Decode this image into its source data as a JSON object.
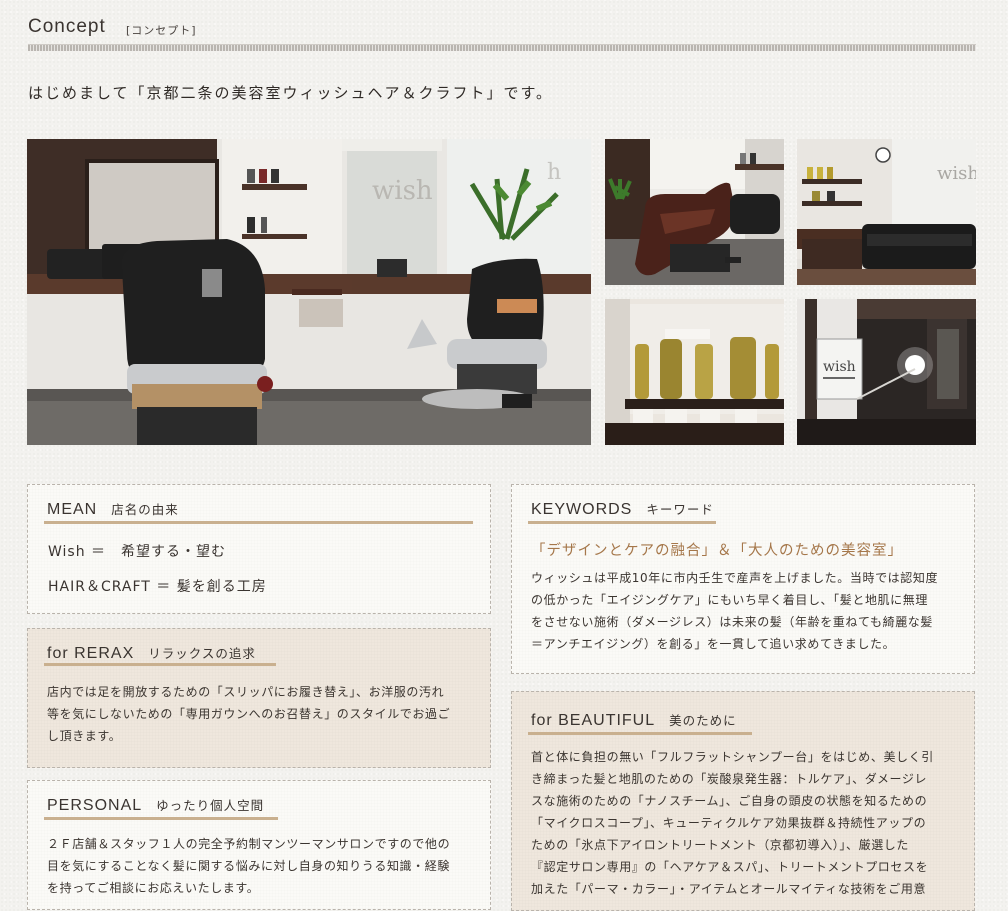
{
  "header": {
    "title_en": "Concept",
    "title_jp": "[コンセプト]",
    "intro": "はじめまして「京都二条の美容室ウィッシュヘア＆クラフト」です。"
  },
  "photos": {
    "main_sign_text": "wish",
    "small_sign_text": "wish",
    "icons": [
      "salon-interior-photo",
      "shampoo-chair-photo",
      "waiting-area-photo",
      "product-shelf-photo",
      "shop-sign-photo"
    ]
  },
  "mean": {
    "title_en": "MEAN",
    "title_jp": "店名の由来",
    "line1": "Wish ＝　希望する・望む",
    "line2": "HAIR＆CRAFT ＝ 髪を創る工房"
  },
  "relax": {
    "title_en": "for RERAX",
    "title_jp": "リラックスの追求",
    "lines": [
      "店内では足を開放するための「スリッパにお履き替え」、お洋服の汚れ",
      "等を気にしないための「専用ガウンへのお召替え」のスタイルでお過ご",
      "し頂きます。"
    ]
  },
  "personal": {
    "title_en": "PERSONAL",
    "title_jp": "ゆったり個人空間",
    "lines": [
      "２Ｆ店舗＆スタッフ１人の完全予約制マンツーマンサロンですので他の",
      "目を気にすることなく髪に関する悩みに対し自身の知りうる知識・経験",
      "を持ってご相談にお応えいたします。"
    ]
  },
  "keywords": {
    "title_en": "KEYWORDS",
    "title_jp": "キーワード",
    "headline": "「デザインとケアの融合」＆「大人のための美容室」",
    "lines": [
      "ウィッシュは平成10年に市内壬生で産声を上げました。当時では認知度",
      "の低かった「エイジングケア」にもいち早く着目し、「髪と地肌に無理",
      "をさせない施術（ダメージレス）は未来の髪（年齢を重ねても綺麗な髪",
      "＝アンチエイジング）を創る」を一貫して追い求めてきました。"
    ]
  },
  "beautiful": {
    "title_en": "for BEAUTIFUL",
    "title_jp": "美のために",
    "lines": [
      "首と体に負担の無い「フルフラットシャンプー台」をはじめ、美しく引",
      "き締まった髪と地肌のための「炭酸泉発生器：トルケア」、ダメージレ",
      "スな施術のための「ナノスチーム」、ご自身の頭皮の状態を知るための",
      "「マイクロスコープ」、キューティクルケア効果抜群＆持続性アップの",
      "ための「氷点下アイロントリートメント（京都初導入）」、厳選した",
      "『認定サロン専用』の「ヘアケア＆スパ」、トリートメントプロセスを",
      "加えた「パーマ・カラー」・アイテムとオールマイティな技術をご用意"
    ]
  },
  "colors": {
    "accent_line": "#c9b08f",
    "headline_text": "#a5774a",
    "beige_box": "#efe7dd",
    "white_box": "#fbfaf7"
  }
}
